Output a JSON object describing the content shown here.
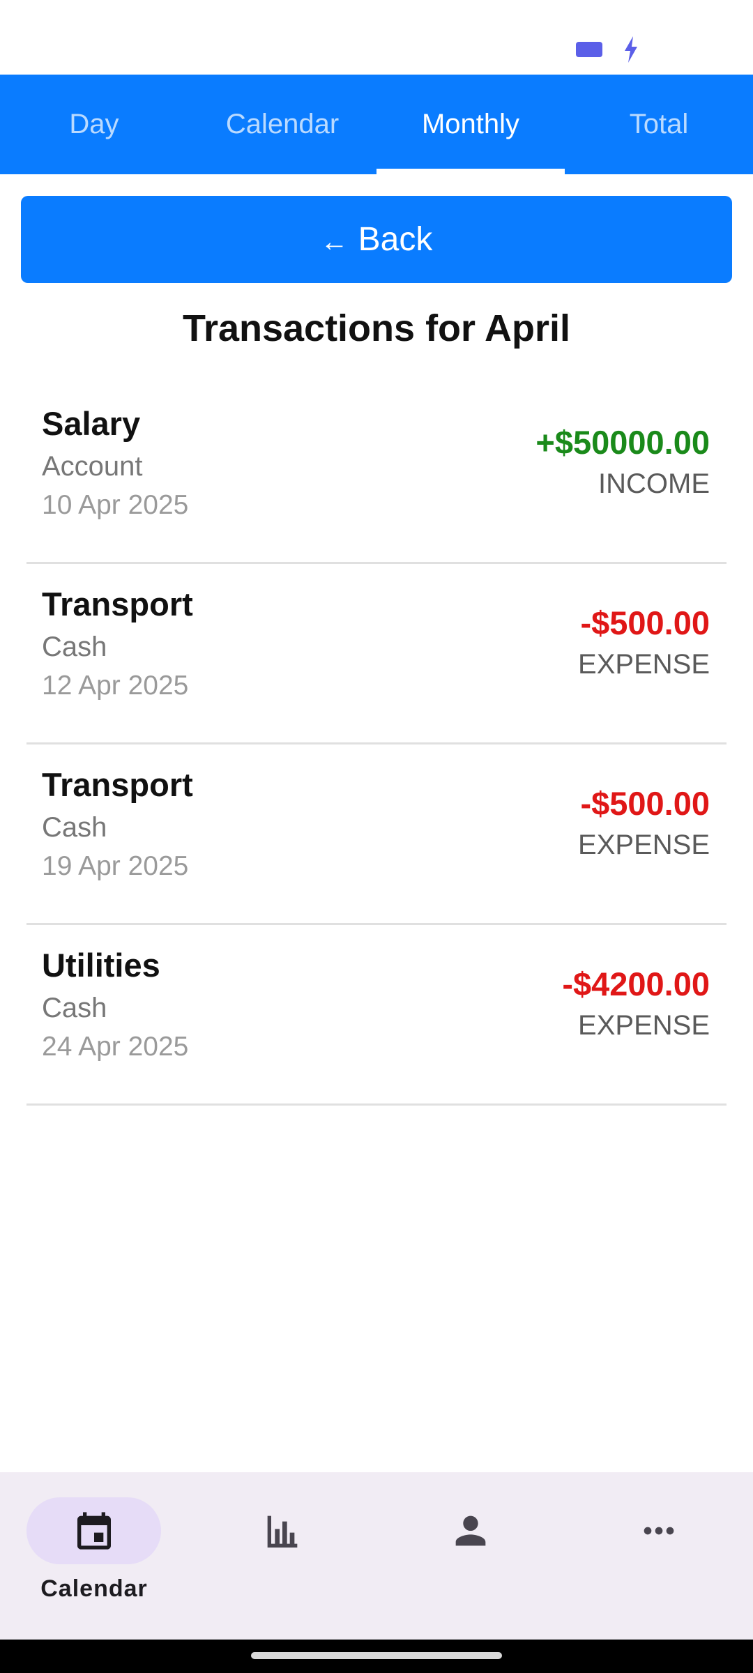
{
  "colors": {
    "primary": "#0a7cff",
    "income": "#1a8a1a",
    "expense": "#e01717",
    "nav_background": "#f1ecf4",
    "nav_active_pill": "#e6dcf7"
  },
  "status_bar": {
    "icons": [
      "battery-icon",
      "charging-bolt-icon"
    ]
  },
  "tabs": [
    {
      "label": "Day",
      "active": false
    },
    {
      "label": "Calendar",
      "active": false
    },
    {
      "label": "Monthly",
      "active": true
    },
    {
      "label": "Total",
      "active": false
    }
  ],
  "back_button": {
    "arrow": "←",
    "label": "Back"
  },
  "page_title": "Transactions for April",
  "transactions": [
    {
      "category": "Salary",
      "account": "Account",
      "date": "10 Apr 2025",
      "amount": "+$50000.00",
      "type": "INCOME"
    },
    {
      "category": "Transport",
      "account": "Cash",
      "date": "12 Apr 2025",
      "amount": "-$500.00",
      "type": "EXPENSE"
    },
    {
      "category": "Transport",
      "account": "Cash",
      "date": "19 Apr 2025",
      "amount": "-$500.00",
      "type": "EXPENSE"
    },
    {
      "category": "Utilities",
      "account": "Cash",
      "date": "24 Apr 2025",
      "amount": "-$4200.00",
      "type": "EXPENSE"
    }
  ],
  "bottom_nav": [
    {
      "icon": "calendar-icon",
      "label": "Calendar",
      "active": true
    },
    {
      "icon": "bar-chart-icon",
      "label": "",
      "active": false
    },
    {
      "icon": "person-icon",
      "label": "",
      "active": false
    },
    {
      "icon": "more-horizontal-icon",
      "label": "",
      "active": false
    }
  ]
}
